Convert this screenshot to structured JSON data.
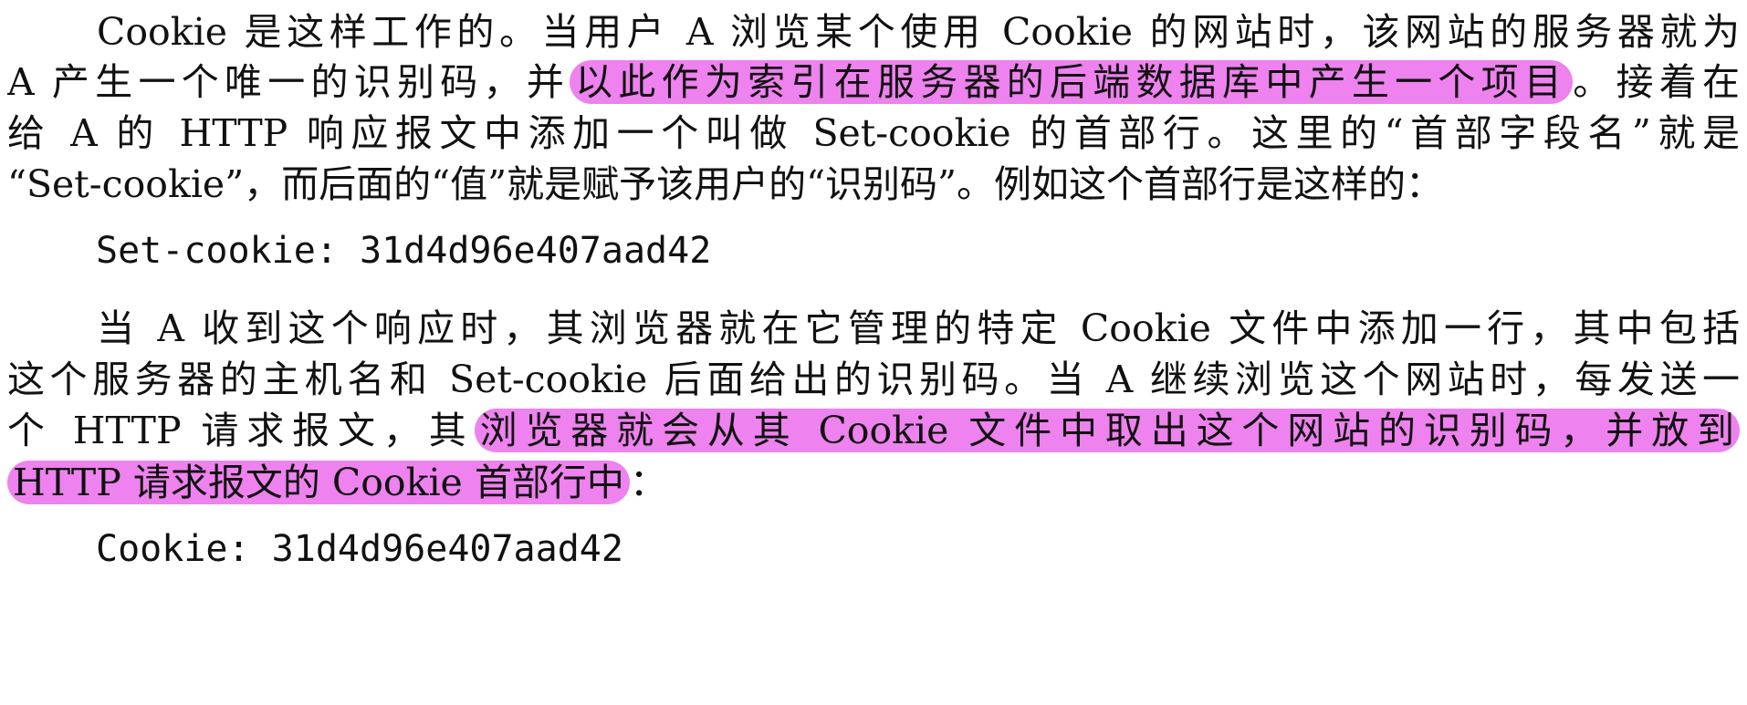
{
  "paragraph1": {
    "line1": "Cookie 是这样工作的。当用户 A 浏览某个使用 Cookie 的网站时，该网站的服务器就为",
    "line2_pre": "A 产生一个唯一的识别码，并",
    "line2_hl": "以此作为索引在服务器的后端数据库中产生一个项目",
    "line2_post": "。接着在",
    "line3": "给 A 的 HTTP 响应报文中添加一个叫做 Set-cookie 的首部行。这里的“首部字段名”就是",
    "line4": "“Set-cookie”，而后面的“值”就是赋予该用户的“识别码”。例如这个首部行是这样的："
  },
  "code1": "Set-cookie: 31d4d96e407aad42",
  "paragraph2": {
    "line1": "当 A 收到这个响应时，其浏览器就在它管理的特定 Cookie 文件中添加一行，其中包括",
    "line2": "这个服务器的主机名和 Set-cookie 后面给出的识别码。当 A 继续浏览这个网站时，每发送一",
    "line3_pre": "个 HTTP 请求报文，其",
    "line3_hl": "浏览器就会从其 Cookie 文件中取出这个网站的识别码，并放到",
    "line4_hl": "HTTP 请求报文的 Cookie 首部行中",
    "line4_post": "："
  },
  "code2": "Cookie: 31d4d96e407aad42",
  "highlight_color": "#ee82ee"
}
